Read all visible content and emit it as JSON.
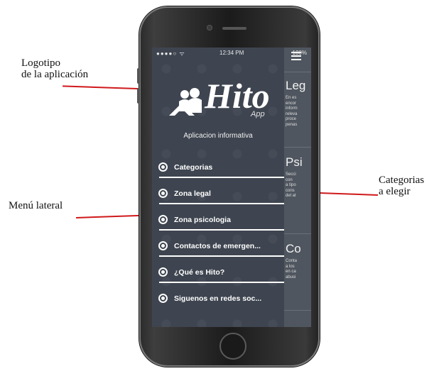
{
  "annotations": {
    "logo_label_line1": "Logotipo",
    "logo_label_line2": "de la aplicación",
    "menu_label": "Menú lateral",
    "categories_label_line1": "Categorias",
    "categories_label_line2": "a elegir"
  },
  "status_bar": {
    "signal": "●●●●○ ᯤ",
    "time": "12:34 PM",
    "battery": "100%"
  },
  "drawer": {
    "logo_text": "Hito",
    "logo_sub": "App",
    "subtitle": "Aplicacion informativa",
    "menu_items": [
      {
        "label": "Categorias"
      },
      {
        "label": "Zona legal"
      },
      {
        "label": "Zona psicologia"
      },
      {
        "label": "Contactos de emergen..."
      },
      {
        "label": "¿Qué es Hito?"
      },
      {
        "label": "Siguenos en redes soc..."
      }
    ]
  },
  "peek_cards": [
    {
      "title": "Leg",
      "text": "En es\nencor\ninform\nreleva\nproce\npenas"
    },
    {
      "title": "Psi",
      "text": "Secci\ncon\na tipo\ncons\ndel at"
    },
    {
      "title": "Co",
      "text": "Conta\na los\nen ca\nabusi"
    }
  ],
  "colors": {
    "drawer_bg": "#3e4550",
    "peek_bg": "#4f565f",
    "arrow": "#d0191b"
  }
}
